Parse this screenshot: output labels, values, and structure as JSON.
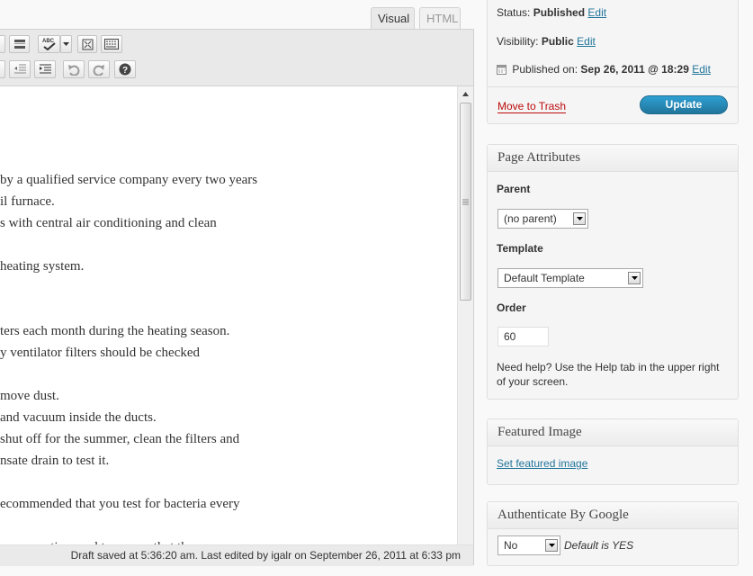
{
  "editor": {
    "tabs": {
      "visual": "Visual",
      "html": "HTML"
    },
    "toolbar": {
      "row1": [
        "more-tag-icon",
        "spellcheck-icon",
        "dropdown-arrow-icon",
        "fullscreen-icon",
        "kitchen-sink-icon"
      ],
      "row2": [
        "indent-icon",
        "outdent-icon",
        "undo-icon",
        "redo-icon",
        "help-icon"
      ],
      "spellcheck_label": "ABC"
    },
    "content_lines": [
      "by a qualified service company every two years",
      "il furnace.",
      "s with central air conditioning and clean",
      "heating system.",
      "ters each month during the heating season.",
      "y ventilator filters should be checked",
      "move dust.",
      " and vacuum inside the ducts.",
      "shut off for the summer, clean the filters and",
      "nsate drain to test it.",
      "ecommended that you test for bacteria every",
      "per operation, and to ensure that there are no"
    ],
    "status": "Draft saved at 5:36:20 am. Last edited by igalr on September 26, 2011 at 6:33 pm"
  },
  "publish": {
    "status_label": "Status:",
    "status_value": "Published",
    "status_edit": "Edit",
    "visibility_label": "Visibility:",
    "visibility_value": "Public",
    "visibility_edit": "Edit",
    "published_label": "Published on:",
    "published_value": "Sep 26, 2011 @ 18:29",
    "published_edit": "Edit",
    "trash": "Move to Trash",
    "update": "Update"
  },
  "page_attributes": {
    "title": "Page Attributes",
    "parent_label": "Parent",
    "parent_value": "(no parent)",
    "template_label": "Template",
    "template_value": "Default Template",
    "order_label": "Order",
    "order_value": "60",
    "help_line1": "Need help? Use the Help tab in the upper right",
    "help_line2": "of your screen."
  },
  "featured_image": {
    "title": "Featured Image",
    "link": "Set featured image"
  },
  "authenticate": {
    "title": "Authenticate By Google",
    "select_value": "No",
    "note": "Default is YES"
  },
  "colors": {
    "accent": "#21759b",
    "trash": "#bc0b0b",
    "update_button": "#2688bb"
  }
}
